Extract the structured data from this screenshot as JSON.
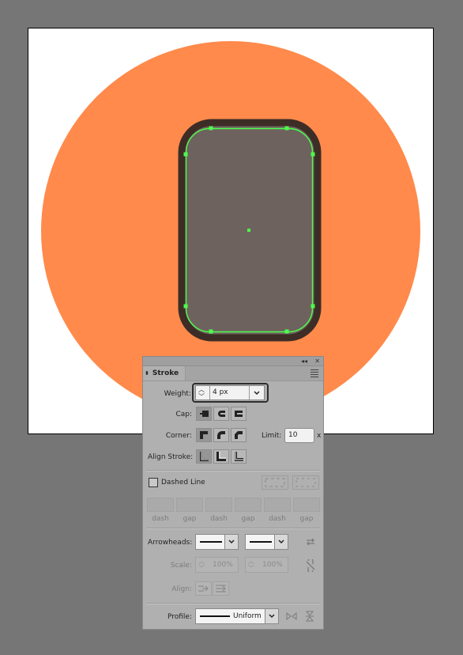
{
  "canvas": {
    "background_color": "#767676",
    "artboard_color": "#ffffff",
    "circle_color": "#ff8a4b",
    "shape_fill": "#6e625e",
    "shape_stroke": "#3e2d27",
    "selection_color": "#4cff4c"
  },
  "panel": {
    "tab_label": "Stroke",
    "collapse_icon": "double-chevron-left-icon",
    "close_icon": "close-icon",
    "menu_icon": "panel-menu-icon",
    "weight": {
      "label": "Weight:",
      "value": "4 px"
    },
    "cap": {
      "label": "Cap:"
    },
    "corner": {
      "label": "Corner:",
      "limit_label": "Limit:",
      "limit_value": "10",
      "limit_unit": "x"
    },
    "align_stroke": {
      "label": "Align Stroke:"
    },
    "dashed": {
      "label": "Dashed Line",
      "checked": false
    },
    "dash_labels": [
      "dash",
      "gap",
      "dash",
      "gap",
      "dash",
      "gap"
    ],
    "arrowheads": {
      "label": "Arrowheads:"
    },
    "scale": {
      "label": "Scale:",
      "start": "100%",
      "end": "100%"
    },
    "align": {
      "label": "Align:"
    },
    "profile": {
      "label": "Profile:",
      "value": "Uniform"
    }
  }
}
